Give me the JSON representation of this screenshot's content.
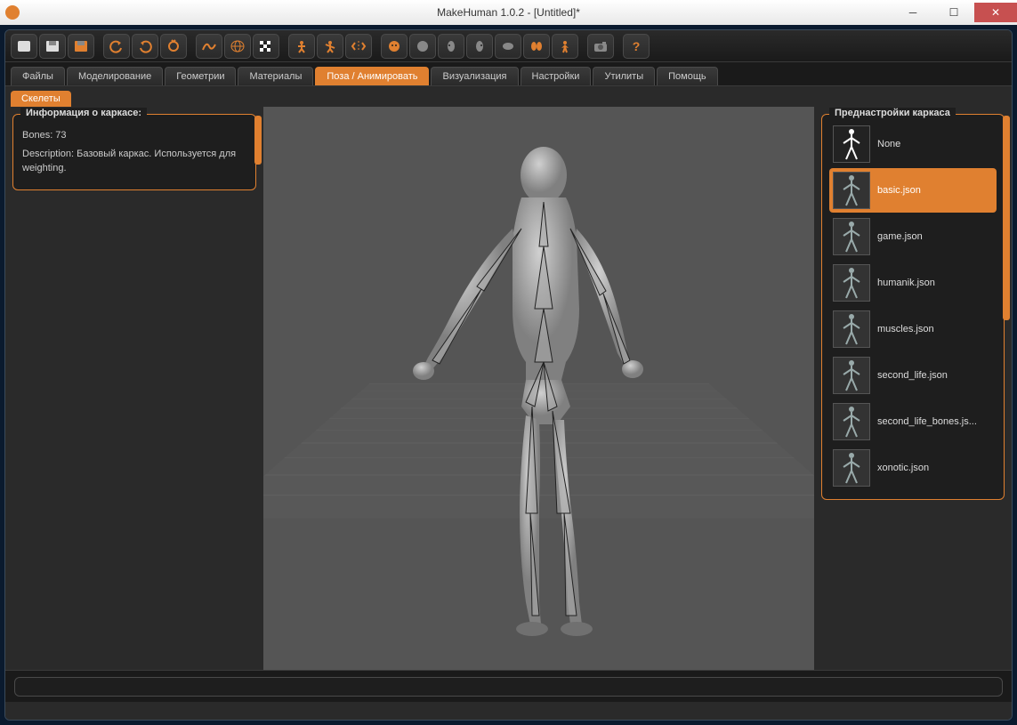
{
  "titlebar": {
    "title": "MakeHuman 1.0.2 - [Untitled]*"
  },
  "tabs": [
    {
      "label": "Файлы"
    },
    {
      "label": "Моделирование"
    },
    {
      "label": "Геометрии"
    },
    {
      "label": "Материалы"
    },
    {
      "label": "Поза / Анимировать",
      "active": true
    },
    {
      "label": "Визуализация"
    },
    {
      "label": "Настройки"
    },
    {
      "label": "Утилиты"
    },
    {
      "label": "Помощь"
    }
  ],
  "subtabs": [
    {
      "label": "Скелеты",
      "active": true
    }
  ],
  "info": {
    "title": "Информация о каркасе:",
    "bones_label": "Bones: 73",
    "description": "Description: Базовый каркас. Используется для weighting."
  },
  "presets": {
    "title": "Преднастройки каркаса",
    "items": [
      {
        "label": "None",
        "selected": false
      },
      {
        "label": "basic.json",
        "selected": true
      },
      {
        "label": "game.json",
        "selected": false
      },
      {
        "label": "humanik.json",
        "selected": false
      },
      {
        "label": "muscles.json",
        "selected": false
      },
      {
        "label": "second_life.json",
        "selected": false
      },
      {
        "label": "second_life_bones.js...",
        "selected": false
      },
      {
        "label": "xonotic.json",
        "selected": false
      }
    ]
  },
  "colors": {
    "accent": "#e08030"
  }
}
